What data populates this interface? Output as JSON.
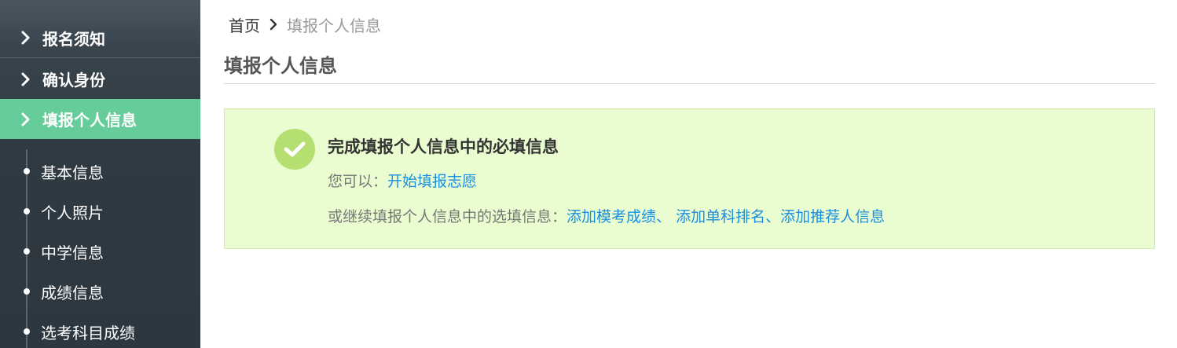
{
  "sidebar": {
    "items": [
      {
        "label": "报名须知"
      },
      {
        "label": "确认身份"
      },
      {
        "label": "填报个人信息"
      }
    ],
    "subitems": [
      {
        "label": "基本信息"
      },
      {
        "label": "个人照片"
      },
      {
        "label": "中学信息"
      },
      {
        "label": "成绩信息"
      },
      {
        "label": "选考科目成绩"
      }
    ],
    "active_color": "#66cc99"
  },
  "breadcrumb": {
    "home": "首页",
    "current": "填报个人信息"
  },
  "page_title": "填报个人信息",
  "success": {
    "title": "完成填报个人信息中的必填信息",
    "line1_prefix": "您可以：",
    "line1_link": "开始填报志愿",
    "line2_prefix": "或继续填报个人信息中的选填信息：",
    "links": [
      "添加模考成绩",
      "添加单科排名",
      "添加推荐人信息"
    ],
    "sep1": "、",
    "sep2": "、",
    "accent": "#b5df70",
    "link_color": "#1a8fe0"
  }
}
